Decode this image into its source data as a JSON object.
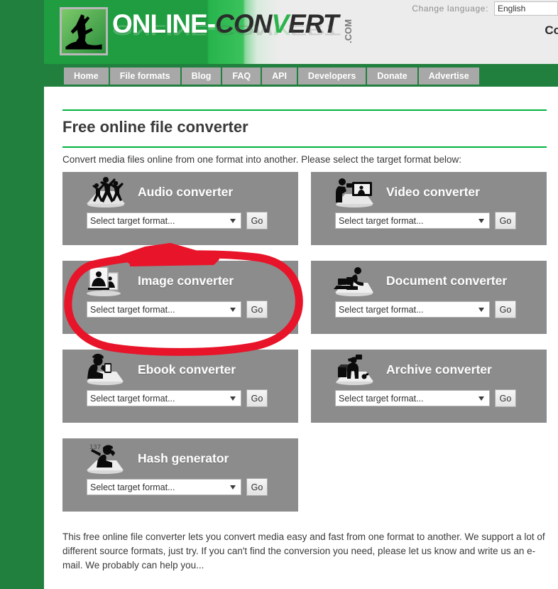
{
  "header": {
    "logo": {
      "part_online": "ONLINE",
      "part_dash": "-",
      "part_con": "CON",
      "part_v": "V",
      "part_ert": "ERT",
      "part_com": ".COM",
      "icon_name": "running-man-logo-icon"
    },
    "language_label": "Change language:",
    "language_value": "English",
    "right_text": "Co",
    "gradient_green": "#1f9d40",
    "gradient_gray": "#ececec"
  },
  "nav": {
    "items": [
      {
        "label": "Home",
        "name": "nav-item-home"
      },
      {
        "label": "File formats",
        "name": "nav-item-file-formats"
      },
      {
        "label": "Blog",
        "name": "nav-item-blog"
      },
      {
        "label": "FAQ",
        "name": "nav-item-faq"
      },
      {
        "label": "API",
        "name": "nav-item-api"
      },
      {
        "label": "Developers",
        "name": "nav-item-developers"
      },
      {
        "label": "Donate",
        "name": "nav-item-donate"
      },
      {
        "label": "Advertise",
        "name": "nav-item-advertise"
      }
    ]
  },
  "main": {
    "page_title": "Free online file converter",
    "intro": "Convert media files online from one format into another. Please select the target format below:",
    "accent_color": "#00b33c",
    "card_bg_color": "#8c8c8c",
    "footer_paragraph": "This free online file converter lets you convert media easy and fast from one format to another. We support a lot of different source formats, just try. If you can't find the conversion you need, please let us know and write us an e-mail. We probably can help you...",
    "cards": [
      {
        "title": "Audio converter",
        "icon_name": "dancing-people-icon",
        "select_value": "Select target format...",
        "go_label": "Go"
      },
      {
        "title": "Video converter",
        "icon_name": "camera-monitor-icon",
        "select_value": "Select target format...",
        "go_label": "Go"
      },
      {
        "title": "Image converter",
        "icon_name": "two-photo-frames-icon",
        "select_value": "Select target format...",
        "go_label": "Go"
      },
      {
        "title": "Document converter",
        "icon_name": "person-at-desk-icon",
        "select_value": "Select target format...",
        "go_label": "Go"
      },
      {
        "title": "Ebook converter",
        "icon_name": "person-reading-tablet-icon",
        "select_value": "Select target format...",
        "go_label": "Go"
      },
      {
        "title": "Archive converter",
        "icon_name": "person-with-box-icon",
        "select_value": "Select target format...",
        "go_label": "Go"
      },
      {
        "title": "Hash generator",
        "icon_name": "person-writing-hash-icon",
        "select_value": "Select target format...",
        "go_label": "Go"
      }
    ]
  },
  "annotation": {
    "color": "#e8142a",
    "shape": "hand-drawn-ellipse-with-tail",
    "target": "Image converter"
  }
}
